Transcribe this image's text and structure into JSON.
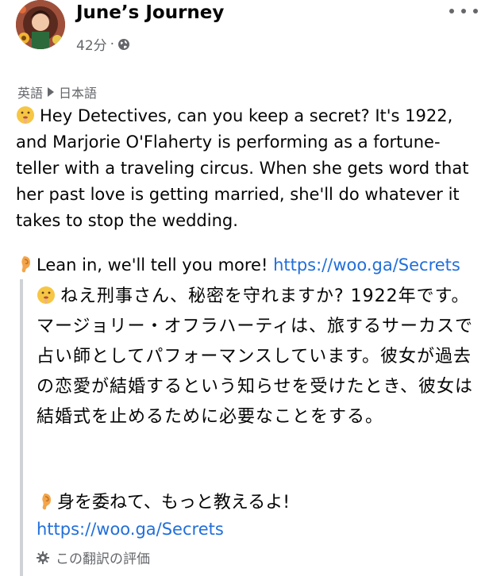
{
  "post": {
    "author": "June’s Journey",
    "time": "42分",
    "separator": "·",
    "privacy_icon": "globe-icon",
    "more_icon": "more-options-icon"
  },
  "translation": {
    "source_lang": "英語",
    "target_lang": "日本語",
    "rate_label": "この翻訳の評価",
    "rate_icon": "gear-icon"
  },
  "content": {
    "en_emoji": "shushing-face-emoji",
    "en_body": "Hey Detectives, can you keep a secret? It's 1922, and Marjorie O'Flaherty is performing as a fortune-teller with a traveling circus. When she gets word that her past love is getting married, she'll do whatever it takes to stop the wedding.",
    "en_lean_emoji": "ear-emoji",
    "en_lean": "Lean in, we'll tell you more! ",
    "link": "https://woo.ga/Secrets",
    "jp_body": "ねえ刑事さん、秘密を守れますか? 1922年です。マージョリー・オフラハーティは、旅するサーカスで占い師としてパフォーマンスしています。彼女が過去の恋愛が結婚するという知らせを受けたとき、彼女は結婚式を止めるために必要なことをする。",
    "jp_lean": "身を委ねて、もっと教えるよ!",
    "jp_link": "https://woo.ga/Secrets"
  },
  "colors": {
    "link": "#216fdb",
    "muted": "#65676b",
    "quote_bar": "#cfd2d6"
  }
}
